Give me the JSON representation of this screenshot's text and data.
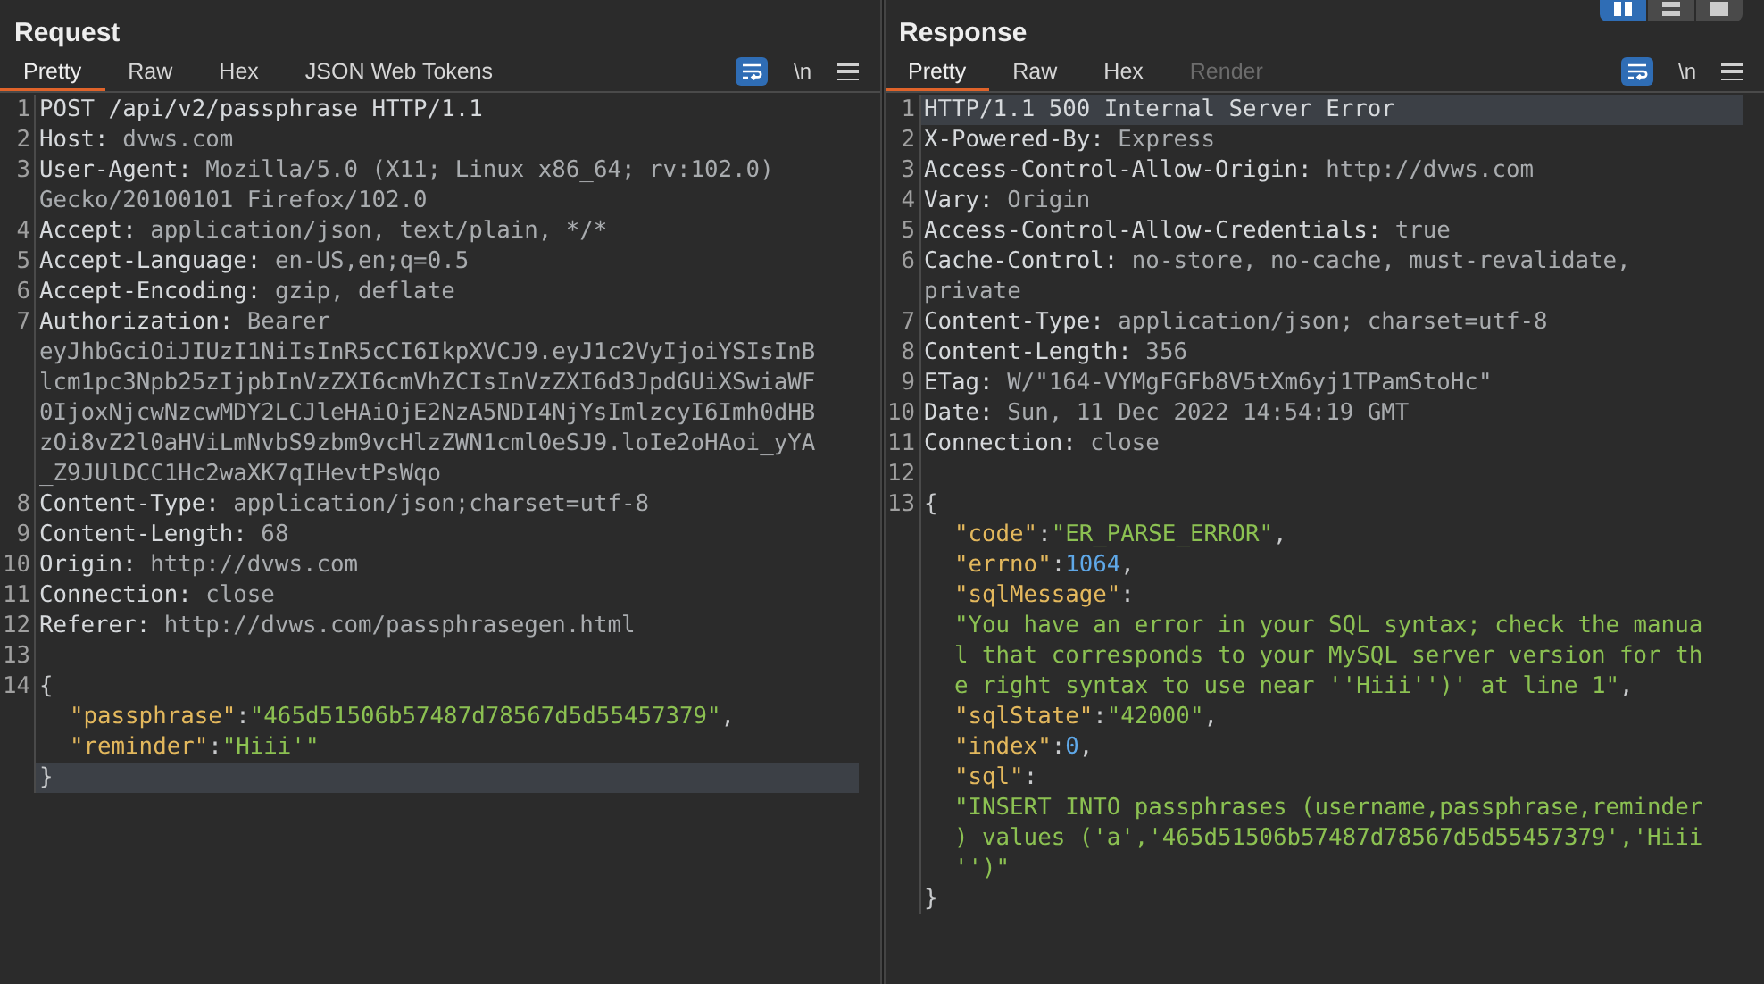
{
  "layout_buttons": [
    {
      "selected": true
    },
    {
      "selected": false
    },
    {
      "selected": false
    }
  ],
  "panels": [
    {
      "title": "Request",
      "tabs": [
        {
          "label": "Pretty",
          "selected": true,
          "disabled": false
        },
        {
          "label": "Raw",
          "selected": false,
          "disabled": false
        },
        {
          "label": "Hex",
          "selected": false,
          "disabled": false
        },
        {
          "label": "JSON Web Tokens",
          "selected": false,
          "disabled": false
        }
      ],
      "tools": {
        "wrap_on": true,
        "newline_label": "\\n"
      },
      "lines": [
        {
          "number": "1",
          "rows": [
            {
              "highlighted": false,
              "indented": false,
              "segments": [
                {
                  "kind": "name",
                  "text": "POST /api/v2/passphrase HTTP/1.1"
                }
              ]
            }
          ]
        },
        {
          "number": "2",
          "rows": [
            {
              "highlighted": false,
              "indented": false,
              "segments": [
                {
                  "kind": "name",
                  "text": "Host:"
                },
                {
                  "kind": "value",
                  "text": " dvws.com"
                }
              ]
            }
          ]
        },
        {
          "number": "3",
          "rows": [
            {
              "highlighted": false,
              "indented": false,
              "segments": [
                {
                  "kind": "name",
                  "text": "User-Agent:"
                },
                {
                  "kind": "value",
                  "text": " Mozilla/5.0 (X11; Linux x86_64; rv:102.0)"
                }
              ]
            },
            {
              "highlighted": false,
              "indented": false,
              "segments": [
                {
                  "kind": "value",
                  "text": "Gecko/20100101 Firefox/102.0"
                }
              ]
            }
          ]
        },
        {
          "number": "4",
          "rows": [
            {
              "highlighted": false,
              "indented": false,
              "segments": [
                {
                  "kind": "name",
                  "text": "Accept:"
                },
                {
                  "kind": "value",
                  "text": " application/json, text/plain, */*"
                }
              ]
            }
          ]
        },
        {
          "number": "5",
          "rows": [
            {
              "highlighted": false,
              "indented": false,
              "segments": [
                {
                  "kind": "name",
                  "text": "Accept-Language:"
                },
                {
                  "kind": "value",
                  "text": " en-US,en;q=0.5"
                }
              ]
            }
          ]
        },
        {
          "number": "6",
          "rows": [
            {
              "highlighted": false,
              "indented": false,
              "segments": [
                {
                  "kind": "name",
                  "text": "Accept-Encoding:"
                },
                {
                  "kind": "value",
                  "text": " gzip, deflate"
                }
              ]
            }
          ]
        },
        {
          "number": "7",
          "rows": [
            {
              "highlighted": false,
              "indented": false,
              "segments": [
                {
                  "kind": "name",
                  "text": "Authorization:"
                },
                {
                  "kind": "value",
                  "text": " Bearer"
                }
              ]
            },
            {
              "highlighted": false,
              "indented": false,
              "segments": [
                {
                  "kind": "value",
                  "text": "eyJhbGciOiJIUzI1NiIsInR5cCI6IkpXVCJ9.eyJ1c2VyIjoiYSIsInB"
                }
              ]
            },
            {
              "highlighted": false,
              "indented": false,
              "segments": [
                {
                  "kind": "value",
                  "text": "lcm1pc3Npb25zIjpbInVzZXI6cmVhZCIsInVzZXI6d3JpdGUiXSwiaWF"
                }
              ]
            },
            {
              "highlighted": false,
              "indented": false,
              "segments": [
                {
                  "kind": "value",
                  "text": "0IjoxNjcwNzcwMDY2LCJleHAiOjE2NzA5NDI4NjYsImlzcyI6Imh0dHB"
                }
              ]
            },
            {
              "highlighted": false,
              "indented": false,
              "segments": [
                {
                  "kind": "value",
                  "text": "zOi8vZ2l0aHViLmNvbS9zbm9vcHlzZWN1cml0eSJ9.loIe2oHAoi_yYA"
                }
              ]
            },
            {
              "highlighted": false,
              "indented": false,
              "segments": [
                {
                  "kind": "value",
                  "text": "_Z9JUlDCC1Hc2waXK7qIHevtPsWqo"
                }
              ]
            }
          ]
        },
        {
          "number": "8",
          "rows": [
            {
              "highlighted": false,
              "indented": false,
              "segments": [
                {
                  "kind": "name",
                  "text": "Content-Type:"
                },
                {
                  "kind": "value",
                  "text": " application/json;charset=utf-8"
                }
              ]
            }
          ]
        },
        {
          "number": "9",
          "rows": [
            {
              "highlighted": false,
              "indented": false,
              "segments": [
                {
                  "kind": "name",
                  "text": "Content-Length:"
                },
                {
                  "kind": "value",
                  "text": " 68"
                }
              ]
            }
          ]
        },
        {
          "number": "10",
          "rows": [
            {
              "highlighted": false,
              "indented": false,
              "segments": [
                {
                  "kind": "name",
                  "text": "Origin:"
                },
                {
                  "kind": "value",
                  "text": " http://dvws.com"
                }
              ]
            }
          ]
        },
        {
          "number": "11",
          "rows": [
            {
              "highlighted": false,
              "indented": false,
              "segments": [
                {
                  "kind": "name",
                  "text": "Connection:"
                },
                {
                  "kind": "value",
                  "text": " close"
                }
              ]
            }
          ]
        },
        {
          "number": "12",
          "rows": [
            {
              "highlighted": false,
              "indented": false,
              "segments": [
                {
                  "kind": "name",
                  "text": "Referer:"
                },
                {
                  "kind": "value",
                  "text": " http://dvws.com/passphrasegen.html"
                }
              ]
            }
          ]
        },
        {
          "number": "13"
        },
        {
          "number": "14",
          "rows": [
            {
              "highlighted": false,
              "indented": false,
              "segments": [
                {
                  "kind": "punct",
                  "text": "{"
                }
              ]
            },
            {
              "highlighted": false,
              "indented": true,
              "segments": [
                {
                  "kind": "key",
                  "text": "\"passphrase\""
                },
                {
                  "kind": "punct",
                  "text": ":"
                },
                {
                  "kind": "string",
                  "text": "\"465d51506b57487d78567d5d55457379\""
                },
                {
                  "kind": "punct",
                  "text": ","
                }
              ]
            },
            {
              "highlighted": false,
              "indented": true,
              "segments": [
                {
                  "kind": "key",
                  "text": "\"reminder\""
                },
                {
                  "kind": "punct",
                  "text": ":"
                },
                {
                  "kind": "string",
                  "text": "\"Hiii'\""
                }
              ]
            },
            {
              "highlighted": true,
              "indented": false,
              "segments": [
                {
                  "kind": "punct",
                  "text": "}"
                }
              ]
            }
          ]
        }
      ]
    },
    {
      "title": "Response",
      "tabs": [
        {
          "label": "Pretty",
          "selected": true,
          "disabled": false
        },
        {
          "label": "Raw",
          "selected": false,
          "disabled": false
        },
        {
          "label": "Hex",
          "selected": false,
          "disabled": false
        },
        {
          "label": "Render",
          "selected": false,
          "disabled": true
        }
      ],
      "tools": {
        "wrap_on": true,
        "newline_label": "\\n"
      },
      "lines": [
        {
          "number": "1",
          "rows": [
            {
              "highlighted": true,
              "indented": false,
              "segments": [
                {
                  "kind": "name",
                  "text": "HTTP/1.1 500 Internal Server Error"
                }
              ]
            }
          ]
        },
        {
          "number": "2",
          "rows": [
            {
              "highlighted": false,
              "indented": false,
              "segments": [
                {
                  "kind": "name",
                  "text": "X-Powered-By:"
                },
                {
                  "kind": "value",
                  "text": " Express"
                }
              ]
            }
          ]
        },
        {
          "number": "3",
          "rows": [
            {
              "highlighted": false,
              "indented": false,
              "segments": [
                {
                  "kind": "name",
                  "text": "Access-Control-Allow-Origin:"
                },
                {
                  "kind": "value",
                  "text": " http://dvws.com"
                }
              ]
            }
          ]
        },
        {
          "number": "4",
          "rows": [
            {
              "highlighted": false,
              "indented": false,
              "segments": [
                {
                  "kind": "name",
                  "text": "Vary:"
                },
                {
                  "kind": "value",
                  "text": " Origin"
                }
              ]
            }
          ]
        },
        {
          "number": "5",
          "rows": [
            {
              "highlighted": false,
              "indented": false,
              "segments": [
                {
                  "kind": "name",
                  "text": "Access-Control-Allow-Credentials:"
                },
                {
                  "kind": "value",
                  "text": " true"
                }
              ]
            }
          ]
        },
        {
          "number": "6",
          "rows": [
            {
              "highlighted": false,
              "indented": false,
              "segments": [
                {
                  "kind": "name",
                  "text": "Cache-Control:"
                },
                {
                  "kind": "value",
                  "text": " no-store, no-cache, must-revalidate,"
                }
              ]
            },
            {
              "highlighted": false,
              "indented": false,
              "segments": [
                {
                  "kind": "value",
                  "text": "private"
                }
              ]
            }
          ]
        },
        {
          "number": "7",
          "rows": [
            {
              "highlighted": false,
              "indented": false,
              "segments": [
                {
                  "kind": "name",
                  "text": "Content-Type:"
                },
                {
                  "kind": "value",
                  "text": " application/json; charset=utf-8"
                }
              ]
            }
          ]
        },
        {
          "number": "8",
          "rows": [
            {
              "highlighted": false,
              "indented": false,
              "segments": [
                {
                  "kind": "name",
                  "text": "Content-Length:"
                },
                {
                  "kind": "value",
                  "text": " 356"
                }
              ]
            }
          ]
        },
        {
          "number": "9",
          "rows": [
            {
              "highlighted": false,
              "indented": false,
              "segments": [
                {
                  "kind": "name",
                  "text": "ETag:"
                },
                {
                  "kind": "value",
                  "text": " W/\"164-VYMgFGFb8V5tXm6yj1TPamStoHc\""
                }
              ]
            }
          ]
        },
        {
          "number": "10",
          "rows": [
            {
              "highlighted": false,
              "indented": false,
              "segments": [
                {
                  "kind": "name",
                  "text": "Date:"
                },
                {
                  "kind": "value",
                  "text": " Sun, 11 Dec 2022 14:54:19 GMT"
                }
              ]
            }
          ]
        },
        {
          "number": "11",
          "rows": [
            {
              "highlighted": false,
              "indented": false,
              "segments": [
                {
                  "kind": "name",
                  "text": "Connection:"
                },
                {
                  "kind": "value",
                  "text": " close"
                }
              ]
            }
          ]
        },
        {
          "number": "12"
        },
        {
          "number": "13",
          "rows": [
            {
              "highlighted": false,
              "indented": false,
              "segments": [
                {
                  "kind": "punct",
                  "text": "{"
                }
              ]
            },
            {
              "highlighted": false,
              "indented": true,
              "segments": [
                {
                  "kind": "key",
                  "text": "\"code\""
                },
                {
                  "kind": "punct",
                  "text": ":"
                },
                {
                  "kind": "string",
                  "text": "\"ER_PARSE_ERROR\""
                },
                {
                  "kind": "punct",
                  "text": ","
                }
              ]
            },
            {
              "highlighted": false,
              "indented": true,
              "segments": [
                {
                  "kind": "key",
                  "text": "\"errno\""
                },
                {
                  "kind": "punct",
                  "text": ":"
                },
                {
                  "kind": "number",
                  "text": "1064"
                },
                {
                  "kind": "punct",
                  "text": ","
                }
              ]
            },
            {
              "highlighted": false,
              "indented": true,
              "segments": [
                {
                  "kind": "key",
                  "text": "\"sqlMessage\""
                },
                {
                  "kind": "punct",
                  "text": ":"
                }
              ]
            },
            {
              "highlighted": false,
              "indented": true,
              "segments": [
                {
                  "kind": "string",
                  "text": "\"You have an error in your SQL syntax; check the manua"
                }
              ]
            },
            {
              "highlighted": false,
              "indented": true,
              "segments": [
                {
                  "kind": "string",
                  "text": "l that corresponds to your MySQL server version for th"
                }
              ]
            },
            {
              "highlighted": false,
              "indented": true,
              "segments": [
                {
                  "kind": "string",
                  "text": "e right syntax to use near ''Hiii'')' at line 1\""
                },
                {
                  "kind": "punct",
                  "text": ","
                }
              ]
            },
            {
              "highlighted": false,
              "indented": true,
              "segments": [
                {
                  "kind": "key",
                  "text": "\"sqlState\""
                },
                {
                  "kind": "punct",
                  "text": ":"
                },
                {
                  "kind": "string",
                  "text": "\"42000\""
                },
                {
                  "kind": "punct",
                  "text": ","
                }
              ]
            },
            {
              "highlighted": false,
              "indented": true,
              "segments": [
                {
                  "kind": "key",
                  "text": "\"index\""
                },
                {
                  "kind": "punct",
                  "text": ":"
                },
                {
                  "kind": "number",
                  "text": "0"
                },
                {
                  "kind": "punct",
                  "text": ","
                }
              ]
            },
            {
              "highlighted": false,
              "indented": true,
              "segments": [
                {
                  "kind": "key",
                  "text": "\"sql\""
                },
                {
                  "kind": "punct",
                  "text": ":"
                }
              ]
            },
            {
              "highlighted": false,
              "indented": true,
              "segments": [
                {
                  "kind": "string",
                  "text": "\"INSERT INTO passphrases (username,passphrase,reminder"
                }
              ]
            },
            {
              "highlighted": false,
              "indented": true,
              "segments": [
                {
                  "kind": "string",
                  "text": ") values ('a','465d51506b57487d78567d5d55457379','Hiii"
                }
              ]
            },
            {
              "highlighted": false,
              "indented": true,
              "segments": [
                {
                  "kind": "string",
                  "text": "'')\""
                }
              ]
            },
            {
              "highlighted": false,
              "indented": false,
              "segments": [
                {
                  "kind": "punct",
                  "text": "}"
                }
              ]
            }
          ]
        }
      ]
    }
  ]
}
